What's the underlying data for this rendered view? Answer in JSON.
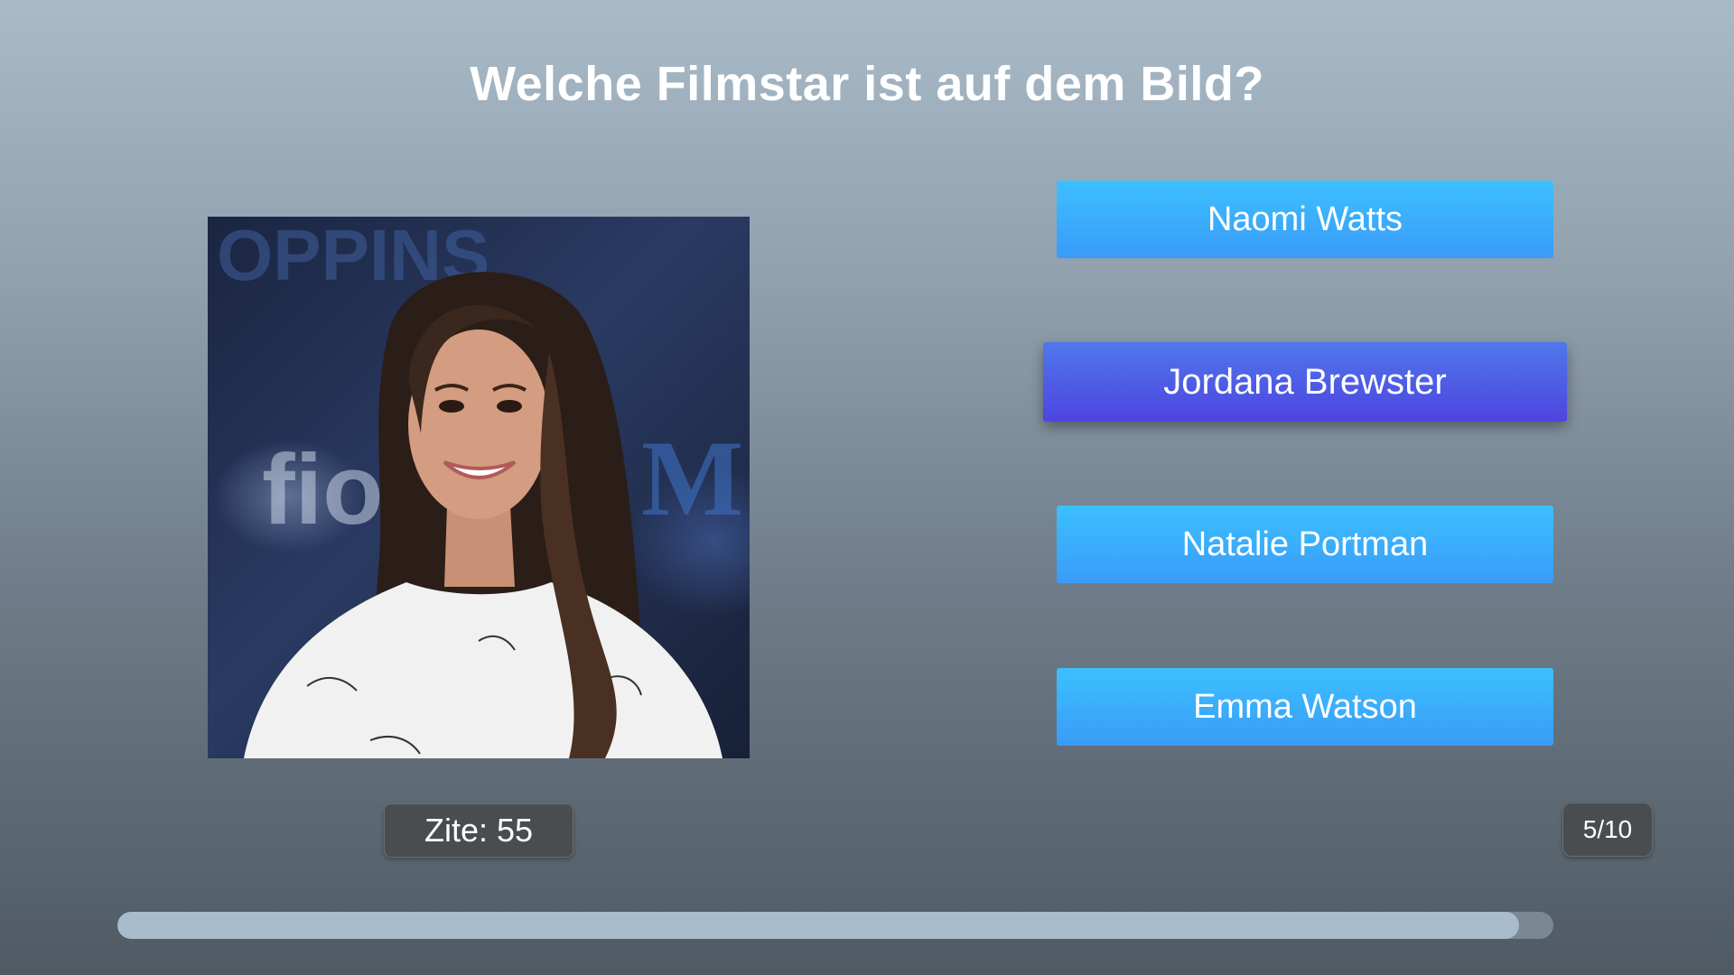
{
  "question": "Welche Filmstar ist auf dem Bild?",
  "photo": {
    "alt": "Porträtfoto einer lächelnden Frau mit langen dunklen Haaren vor einer Premierenwand"
  },
  "answers": [
    {
      "label": "Naomi Watts",
      "selected": false
    },
    {
      "label": "Jordana Brewster",
      "selected": true
    },
    {
      "label": "Natalie Portman",
      "selected": false
    },
    {
      "label": "Emma Watson",
      "selected": false
    }
  ],
  "timer": {
    "text": "Zite: 55"
  },
  "counter": {
    "text": "5/10"
  },
  "progress": {
    "fraction": 0.976
  },
  "colors": {
    "answer_default": "#3aa9fb",
    "answer_selected": "#4d55e4",
    "progress_fill": "#a8bccb",
    "progress_track": "#7b8893"
  }
}
